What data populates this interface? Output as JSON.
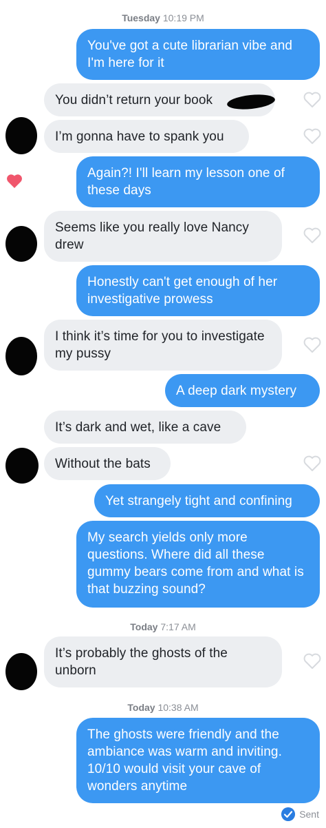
{
  "timestamps": {
    "t1_day": "Tuesday",
    "t1_time": "10:19 PM",
    "t2_day": "Today",
    "t2_time": "7:17 AM",
    "t3_day": "Today",
    "t3_time": "10:38 AM"
  },
  "messages": [
    {
      "text": "You've got a cute librarian vibe and I'm here for it"
    },
    {
      "text": "You didn’t return your book"
    },
    {
      "text": "I’m gonna have to spank you"
    },
    {
      "text": "Again?! I'll learn my lesson one of these days"
    },
    {
      "text": "Seems like you really love Nancy drew"
    },
    {
      "text": "Honestly can't get enough of her investigative prowess"
    },
    {
      "text": "I think it’s time for you to investigate my pussy"
    },
    {
      "text": "A deep dark mystery"
    },
    {
      "text": "It’s dark and wet, like a cave"
    },
    {
      "text": "Without the bats"
    },
    {
      "text": "Yet strangely tight and confining"
    },
    {
      "text": "My search yields only more questions. Where did all these gummy bears come from and what is that buzzing sound?"
    },
    {
      "text": "It’s probably the ghosts of the unborn"
    },
    {
      "text": "The ghosts were friendly and the ambiance was warm and inviting. 10/10 would visit your cave of wonders anytime"
    }
  ],
  "status": {
    "sent_label": "Sent"
  },
  "colors": {
    "outgoing": "#3c98f2",
    "incoming": "#eceef1",
    "like": "#f0566c"
  },
  "icons": [
    "heart-outline-icon",
    "heart-filled-icon",
    "sent-check-icon"
  ]
}
